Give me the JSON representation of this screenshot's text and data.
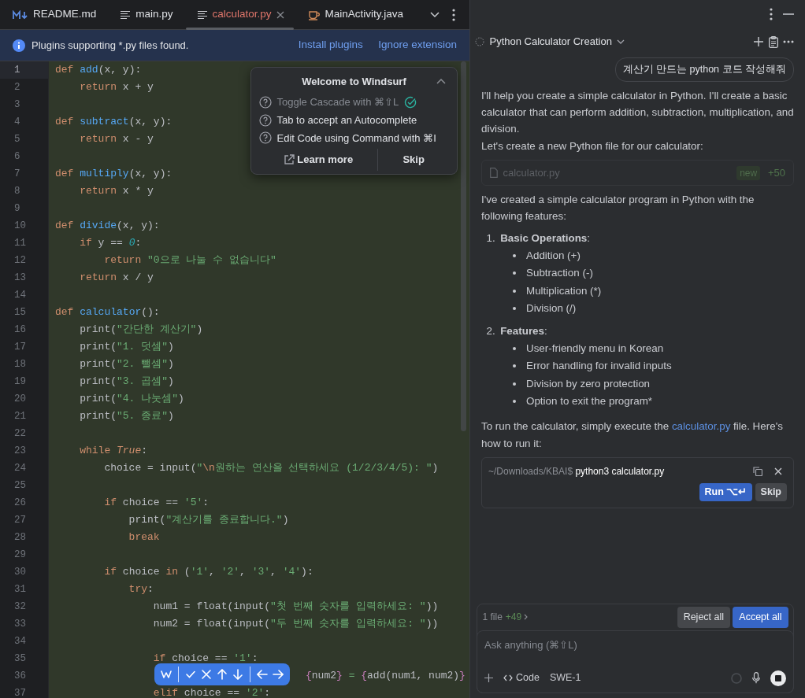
{
  "editor": {
    "tabs": [
      {
        "label": "README.md",
        "kind": "markdown",
        "selected": false
      },
      {
        "label": "main.py",
        "kind": "python",
        "selected": false
      },
      {
        "label": "calculator.py",
        "kind": "python",
        "selected": true
      },
      {
        "label": "MainActivity.java",
        "kind": "java",
        "selected": false
      }
    ],
    "banner": {
      "message": "Plugins supporting *.py files found.",
      "actions": [
        "Install plugins",
        "Ignore extension"
      ]
    },
    "lines": [
      {
        "number": "1",
        "current": true,
        "tokens": [
          {
            "kind": "kw",
            "text": "def "
          },
          {
            "kind": "fn",
            "text": "add"
          },
          {
            "kind": "plain",
            "text": "(x, y):"
          }
        ]
      },
      {
        "number": "2",
        "current": false,
        "tokens": [
          {
            "kind": "kw",
            "text": "    return "
          },
          {
            "kind": "plain",
            "text": "x + y"
          }
        ]
      },
      {
        "number": "3",
        "current": false
      },
      {
        "number": "4",
        "current": false,
        "tokens": [
          {
            "kind": "kw",
            "text": "def "
          },
          {
            "kind": "fn",
            "text": "subtract"
          },
          {
            "kind": "plain",
            "text": "(x, y):"
          }
        ]
      },
      {
        "number": "5",
        "current": false,
        "tokens": [
          {
            "kind": "kw",
            "text": "    return "
          },
          {
            "kind": "plain",
            "text": "x - y"
          }
        ]
      },
      {
        "number": "6",
        "current": false
      },
      {
        "number": "7",
        "current": false,
        "tokens": [
          {
            "kind": "kw",
            "text": "def "
          },
          {
            "kind": "fn",
            "text": "multiply"
          },
          {
            "kind": "plain",
            "text": "(x, y):"
          }
        ]
      },
      {
        "number": "8",
        "current": false,
        "tokens": [
          {
            "kind": "kw",
            "text": "    return "
          },
          {
            "kind": "plain",
            "text": "x * y"
          }
        ]
      },
      {
        "number": "9",
        "current": false
      },
      {
        "number": "10",
        "current": false,
        "tokens": [
          {
            "kind": "kw",
            "text": "def "
          },
          {
            "kind": "fn",
            "text": "divide"
          },
          {
            "kind": "plain",
            "text": "(x, y):"
          }
        ]
      },
      {
        "number": "11",
        "current": false,
        "tokens": [
          {
            "kind": "kw",
            "text": "    if "
          },
          {
            "kind": "plain",
            "text": "y == "
          },
          {
            "kind": "num",
            "text": "0"
          },
          {
            "kind": "plain",
            "text": ":"
          }
        ]
      },
      {
        "number": "12",
        "current": false,
        "tokens": [
          {
            "kind": "kw",
            "text": "        return "
          },
          {
            "kind": "str",
            "text": "\"0으로 나눌 수 없습니다\""
          }
        ]
      },
      {
        "number": "13",
        "current": false,
        "tokens": [
          {
            "kind": "kw",
            "text": "    return "
          },
          {
            "kind": "plain",
            "text": "x / y"
          }
        ]
      },
      {
        "number": "14",
        "current": false
      },
      {
        "number": "15",
        "current": false,
        "tokens": [
          {
            "kind": "kw",
            "text": "def "
          },
          {
            "kind": "fn",
            "text": "calculator"
          },
          {
            "kind": "plain",
            "text": "():"
          }
        ]
      },
      {
        "number": "16",
        "current": false,
        "tokens": [
          {
            "kind": "plain",
            "text": "    print("
          },
          {
            "kind": "str",
            "text": "\"간단한 계산기\""
          },
          {
            "kind": "plain",
            "text": ")"
          }
        ]
      },
      {
        "number": "17",
        "current": false,
        "tokens": [
          {
            "kind": "plain",
            "text": "    print("
          },
          {
            "kind": "str",
            "text": "\"1. 덧셈\""
          },
          {
            "kind": "plain",
            "text": ")"
          }
        ]
      },
      {
        "number": "18",
        "current": false,
        "tokens": [
          {
            "kind": "plain",
            "text": "    print("
          },
          {
            "kind": "str",
            "text": "\"2. 뺄셈\""
          },
          {
            "kind": "plain",
            "text": ")"
          }
        ]
      },
      {
        "number": "19",
        "current": false,
        "tokens": [
          {
            "kind": "plain",
            "text": "    print("
          },
          {
            "kind": "str",
            "text": "\"3. 곱셈\""
          },
          {
            "kind": "plain",
            "text": ")"
          }
        ]
      },
      {
        "number": "20",
        "current": false,
        "tokens": [
          {
            "kind": "plain",
            "text": "    print("
          },
          {
            "kind": "str",
            "text": "\"4. 나눗셈\""
          },
          {
            "kind": "plain",
            "text": ")"
          }
        ]
      },
      {
        "number": "21",
        "current": false,
        "tokens": [
          {
            "kind": "plain",
            "text": "    print("
          },
          {
            "kind": "str",
            "text": "\"5. 종료\""
          },
          {
            "kind": "plain",
            "text": ")"
          }
        ]
      },
      {
        "number": "22",
        "current": false
      },
      {
        "number": "23",
        "current": false,
        "tokens": [
          {
            "kind": "kw",
            "text": "    while "
          },
          {
            "kind": "kwi",
            "text": "True"
          },
          {
            "kind": "plain",
            "text": ":"
          }
        ]
      },
      {
        "number": "24",
        "current": false,
        "tokens": [
          {
            "kind": "plain",
            "text": "        choice = input("
          },
          {
            "kind": "str",
            "text": "\""
          },
          {
            "kind": "esc",
            "text": "\\n"
          },
          {
            "kind": "str",
            "text": "원하는 연산을 선택하세요 (1/2/3/4/5): \""
          },
          {
            "kind": "plain",
            "text": ")"
          }
        ]
      },
      {
        "number": "25",
        "current": false
      },
      {
        "number": "26",
        "current": false,
        "tokens": [
          {
            "kind": "kw",
            "text": "        if "
          },
          {
            "kind": "plain",
            "text": "choice == "
          },
          {
            "kind": "str",
            "text": "'5'"
          },
          {
            "kind": "plain",
            "text": ":"
          }
        ]
      },
      {
        "number": "27",
        "current": false,
        "tokens": [
          {
            "kind": "plain",
            "text": "            print("
          },
          {
            "kind": "str",
            "text": "\"계산기를 종료합니다.\""
          },
          {
            "kind": "plain",
            "text": ")"
          }
        ]
      },
      {
        "number": "28",
        "current": false,
        "tokens": [
          {
            "kind": "kw",
            "text": "            break"
          }
        ]
      },
      {
        "number": "29",
        "current": false
      },
      {
        "number": "30",
        "current": false,
        "tokens": [
          {
            "kind": "kw",
            "text": "        if "
          },
          {
            "kind": "plain",
            "text": "choice "
          },
          {
            "kind": "kw",
            "text": "in "
          },
          {
            "kind": "plain",
            "text": "("
          },
          {
            "kind": "str",
            "text": "'1'"
          },
          {
            "kind": "plain",
            "text": ", "
          },
          {
            "kind": "str",
            "text": "'2'"
          },
          {
            "kind": "plain",
            "text": ", "
          },
          {
            "kind": "str",
            "text": "'3'"
          },
          {
            "kind": "plain",
            "text": ", "
          },
          {
            "kind": "str",
            "text": "'4'"
          },
          {
            "kind": "plain",
            "text": "):"
          }
        ]
      },
      {
        "number": "31",
        "current": false,
        "tokens": [
          {
            "kind": "kw",
            "text": "            try"
          },
          {
            "kind": "plain",
            "text": ":"
          }
        ]
      },
      {
        "number": "32",
        "current": false,
        "tokens": [
          {
            "kind": "plain",
            "text": "                num1 = float(input("
          },
          {
            "kind": "str",
            "text": "\"첫 번째 숫자를 입력하세요: \""
          },
          {
            "kind": "plain",
            "text": "))"
          }
        ]
      },
      {
        "number": "33",
        "current": false,
        "tokens": [
          {
            "kind": "plain",
            "text": "                num2 = float(input("
          },
          {
            "kind": "str",
            "text": "\"두 번째 숫자를 입력하세요: \""
          },
          {
            "kind": "plain",
            "text": "))"
          }
        ]
      },
      {
        "number": "34",
        "current": false
      },
      {
        "number": "35",
        "current": false,
        "tokens": [
          {
            "kind": "kw",
            "text": "                if "
          },
          {
            "kind": "plain",
            "text": "choice == "
          },
          {
            "kind": "str",
            "text": "'1'"
          },
          {
            "kind": "plain",
            "text": ":"
          }
        ]
      },
      {
        "number": "36",
        "current": false,
        "covered": true,
        "tokens": [
          {
            "kind": "brace",
            "text": "{"
          },
          {
            "kind": "plain",
            "text": "num2"
          },
          {
            "kind": "brace",
            "text": "}"
          },
          {
            "kind": "str",
            "text": " = "
          },
          {
            "kind": "brace",
            "text": "{"
          },
          {
            "kind": "plain",
            "text": "add(num1, num2)"
          },
          {
            "kind": "brace",
            "text": "}"
          }
        ]
      },
      {
        "number": "37",
        "current": false,
        "tokens": [
          {
            "kind": "kw",
            "text": "                elif "
          },
          {
            "kind": "plain",
            "text": "choice == "
          },
          {
            "kind": "str",
            "text": "'2'"
          },
          {
            "kind": "plain",
            "text": ":"
          }
        ]
      }
    ],
    "welcome": {
      "title": "Welcome to Windsurf",
      "items": [
        {
          "text": "Toggle Cascade with ⌘⇧L",
          "done": true
        },
        {
          "text": "Tab to accept an Autocomplete",
          "done": false
        },
        {
          "text": "Edit Code using Command with ⌘I",
          "done": false
        }
      ],
      "learn_more": "Learn more",
      "skip": "Skip"
    }
  },
  "chat": {
    "title": "Python Calculator Creation",
    "user_message": "계산기 만드는 python 코드 작성해줘",
    "intro": [
      "I'll help you create a simple calculator in Python. I'll create a basic calculator that can perform addition, subtraction, multiplication, and division.",
      "Let's create a new Python file for our calculator:"
    ],
    "file_card": {
      "name": "calculator.py",
      "badge": "new",
      "added": "+50"
    },
    "summary": "I've created a simple calculator program in Python with the following features:",
    "sections": [
      {
        "number": "1.",
        "heading": "Basic Operations",
        "suffix": ":",
        "items": [
          "Addition (+)",
          "Subtraction (-)",
          "Multiplication (*)",
          "Division (/)"
        ]
      },
      {
        "number": "2.",
        "heading": "Features",
        "suffix": ":",
        "items": [
          "User-friendly menu in Korean",
          "Error handling for invalid inputs",
          "Division by zero protection",
          "Option to exit the program*"
        ]
      }
    ],
    "run_text": {
      "before": "To run the calculator, simply execute the ",
      "link": "calculator.py",
      "after": " file. Here's how to run it:"
    },
    "command": {
      "prompt": "~/Downloads/KBAI$",
      "command": "python3 calculator.py",
      "run": "Run ⌥↵",
      "skip": "Skip"
    },
    "changes": {
      "files": "1 file",
      "added": "+49",
      "reject": "Reject all",
      "accept": "Accept all"
    },
    "input": {
      "placeholder": "Ask anything (⌘⇧L)",
      "mode": "Code",
      "model": "SWE-1"
    }
  }
}
